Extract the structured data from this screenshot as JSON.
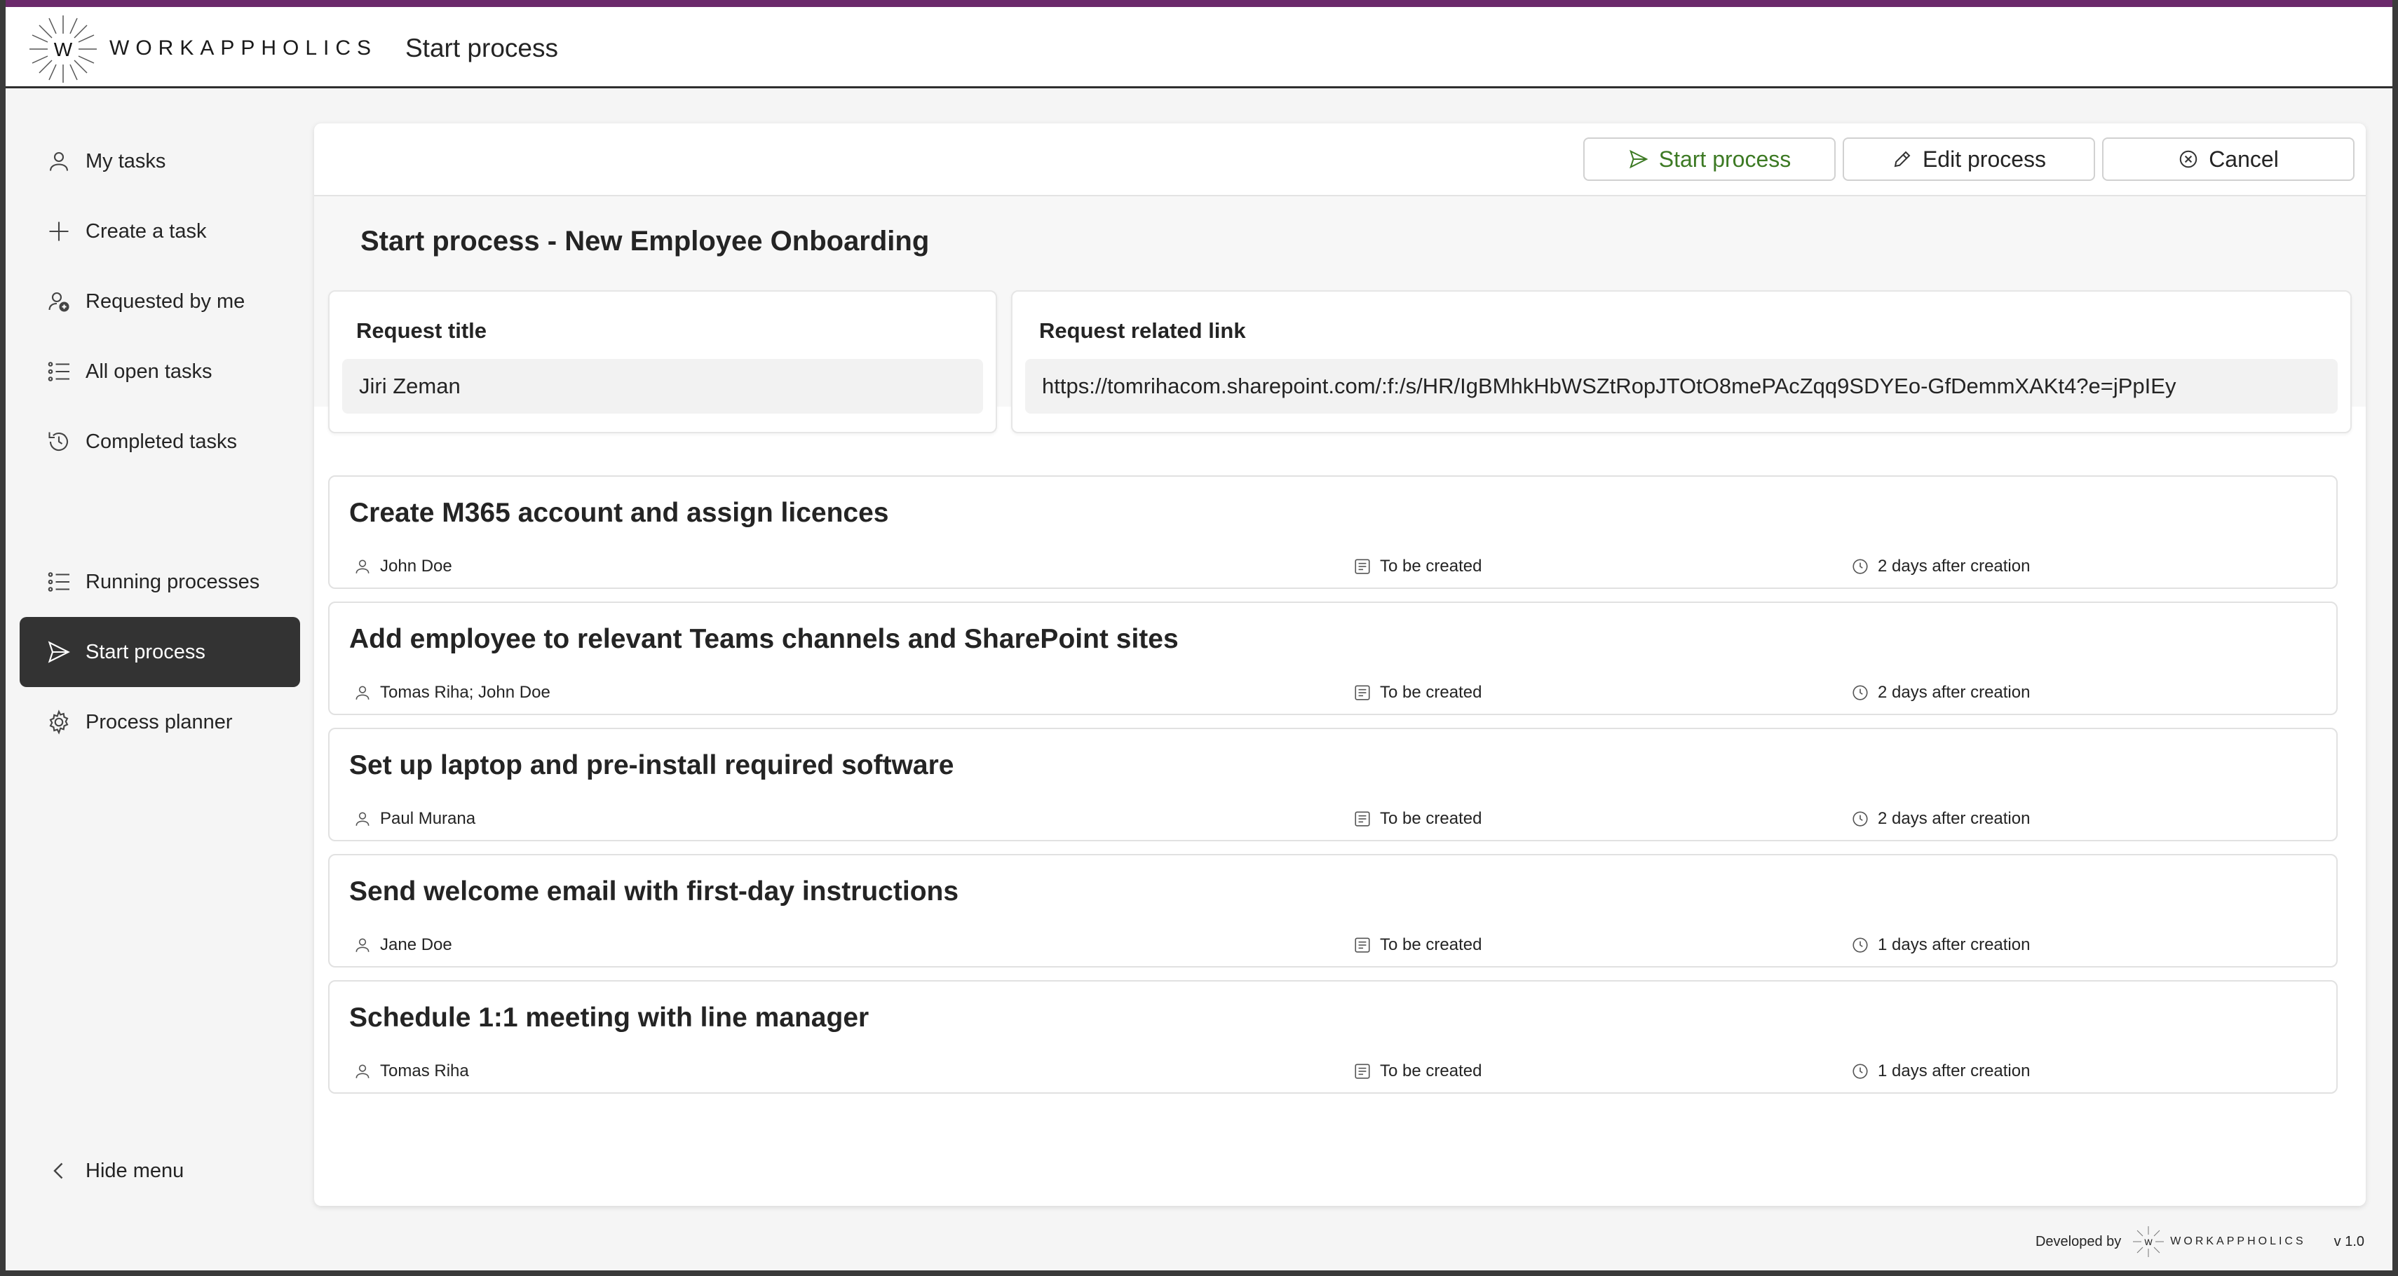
{
  "header": {
    "brand": "WORKAPPHOLICS",
    "logo_letter": "W",
    "title": "Start process",
    "accent_color": "#6b2a6b"
  },
  "sidebar": {
    "items": [
      {
        "label": "My tasks",
        "icon": "person-icon"
      },
      {
        "label": "Create a task",
        "icon": "plus-icon"
      },
      {
        "label": "Requested by me",
        "icon": "person-add-icon"
      },
      {
        "label": "All open tasks",
        "icon": "list-icon"
      },
      {
        "label": "Completed tasks",
        "icon": "history-icon"
      },
      {
        "label": "Running processes",
        "icon": "list-icon"
      },
      {
        "label": "Start process",
        "icon": "send-icon",
        "active": true
      },
      {
        "label": "Process planner",
        "icon": "gear-icon"
      }
    ],
    "hide_menu": "Hide menu"
  },
  "toolbar": {
    "start_label": "Start process",
    "edit_label": "Edit process",
    "cancel_label": "Cancel",
    "start_color": "#3d7a24"
  },
  "main": {
    "title": "Start process - New Employee Onboarding",
    "request_title_label": "Request title",
    "request_title_value": "Jiri Zeman",
    "request_link_label": "Request related link",
    "request_link_value": "https://tomrihacom.sharepoint.com/:f:/s/HR/IgBMhkHbWSZtRopJTOtO8mePAcZqq9SDYEo-GfDemmXAKt4?e=jPpIEy"
  },
  "tasks": [
    {
      "title": "Create M365 account and assign licences",
      "assignee": "John Doe",
      "status": "To be created",
      "due": "2 days after creation"
    },
    {
      "title": "Add employee to relevant Teams channels and SharePoint sites",
      "assignee": "Tomas Riha; John Doe",
      "status": "To be created",
      "due": "2 days after creation"
    },
    {
      "title": "Set up laptop and pre-install required software",
      "assignee": "Paul Murana",
      "status": "To be created",
      "due": "2 days after creation"
    },
    {
      "title": "Send welcome email with first-day instructions",
      "assignee": "Jane Doe",
      "status": "To be created",
      "due": "1 days after creation"
    },
    {
      "title": "Schedule 1:1 meeting with line manager",
      "assignee": "Tomas Riha",
      "status": "To be created",
      "due": "1 days after creation"
    }
  ],
  "footer": {
    "developed_by": "Developed by",
    "brand": "WORKAPPHOLICS",
    "version": "v 1.0"
  }
}
